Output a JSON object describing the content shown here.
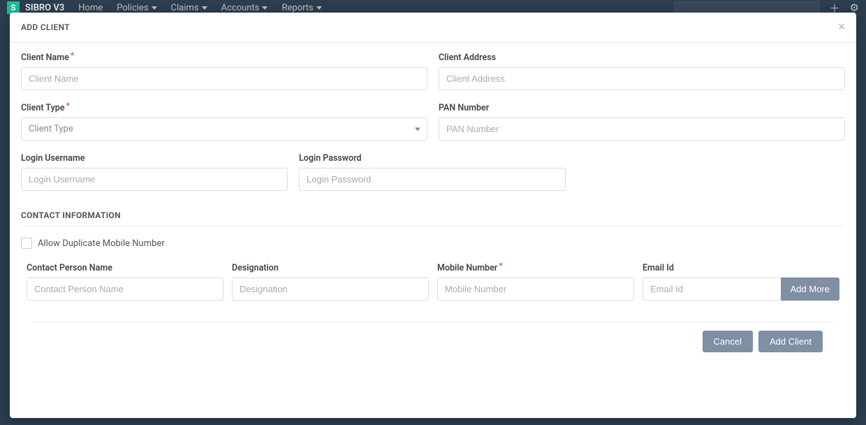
{
  "nav": {
    "brand": "SIBRO V3",
    "items": [
      "Home",
      "Policies",
      "Claims",
      "Accounts",
      "Reports"
    ]
  },
  "modal": {
    "title": "ADD CLIENT",
    "fields": {
      "clientName": {
        "label": "Client Name",
        "placeholder": "Client Name"
      },
      "clientAddress": {
        "label": "Client Address",
        "placeholder": "Client Address"
      },
      "clientType": {
        "label": "Client Type",
        "placeholder": "Client Type"
      },
      "panNumber": {
        "label": "PAN Number",
        "placeholder": "PAN Number"
      },
      "loginUsername": {
        "label": "Login Username",
        "placeholder": "Login Username"
      },
      "loginPassword": {
        "label": "Login Password",
        "placeholder": "Login Password"
      }
    },
    "contactSection": {
      "title": "CONTACT INFORMATION",
      "allowDuplicate": "Allow Duplicate Mobile Number",
      "contactPerson": {
        "label": "Contact Person Name",
        "placeholder": "Contact Person Name"
      },
      "designation": {
        "label": "Designation",
        "placeholder": "Designation"
      },
      "mobile": {
        "label": "Mobile Number",
        "placeholder": "Mobile Number"
      },
      "email": {
        "label": "Email Id",
        "placeholder": "Email Id"
      },
      "addMore": "Add More"
    },
    "buttons": {
      "cancel": "Cancel",
      "addClient": "Add Client"
    }
  }
}
